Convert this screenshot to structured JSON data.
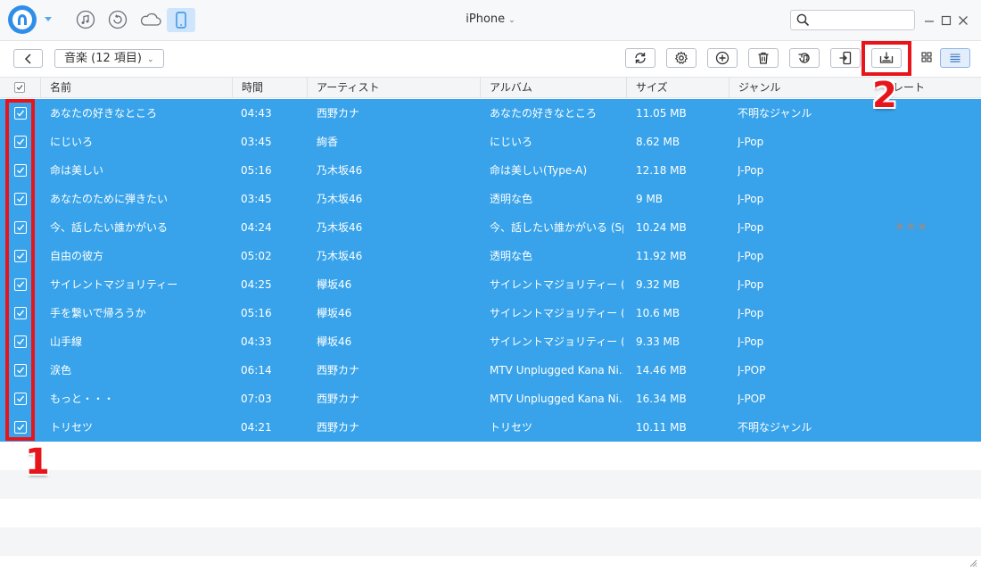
{
  "titlebar": {
    "device_name": "iPhone",
    "dropdown_glyph": "⌄",
    "search": {
      "value": "",
      "placeholder": ""
    },
    "mode_icons": [
      "music-icon",
      "restore-icon",
      "cloud-icon",
      "phone-icon"
    ],
    "accent_color": "#2f8fe8"
  },
  "toolbar": {
    "category_label": "音楽 (12 項目)",
    "dropdown_glyph": "⌄",
    "buttons": [
      "refresh-icon",
      "settings-icon",
      "add-icon",
      "delete-icon",
      "to-itunes-icon",
      "to-device-icon",
      "to-computer-icon",
      "grid-view-icon",
      "list-view-icon"
    ]
  },
  "table": {
    "columns": {
      "name": "名前",
      "time": "時間",
      "artist": "アーティスト",
      "album": "アルバム",
      "size": "サイズ",
      "genre": "ジャンル",
      "rating": "レート"
    },
    "selection_color": "#38a3ea",
    "rows": [
      {
        "name": "あなたの好きなところ",
        "time": "04:43",
        "artist": "西野カナ",
        "album": "あなたの好きなところ",
        "size": "11.05 MB",
        "genre": "不明なジャンル",
        "rating": ""
      },
      {
        "name": "にじいろ",
        "time": "03:45",
        "artist": "絢香",
        "album": "にじいろ",
        "size": "8.62 MB",
        "genre": "J-Pop",
        "rating": ""
      },
      {
        "name": "命は美しい",
        "time": "05:16",
        "artist": "乃木坂46",
        "album": "命は美しい(Type-A)",
        "size": "12.18 MB",
        "genre": "J-Pop",
        "rating": ""
      },
      {
        "name": "あなたのために弾きたい",
        "time": "03:45",
        "artist": "乃木坂46",
        "album": "透明な色",
        "size": "9 MB",
        "genre": "J-Pop",
        "rating": ""
      },
      {
        "name": "今、話したい誰かがいる",
        "time": "04:24",
        "artist": "乃木坂46",
        "album": "今、話したい誰かがいる (Sp...",
        "size": "10.24 MB",
        "genre": "J-Pop",
        "rating": "★★★"
      },
      {
        "name": "自由の彼方",
        "time": "05:02",
        "artist": "乃木坂46",
        "album": "透明な色",
        "size": "11.92 MB",
        "genre": "J-Pop",
        "rating": ""
      },
      {
        "name": "サイレントマジョリティー",
        "time": "04:25",
        "artist": "欅坂46",
        "album": "サイレントマジョリティー (Spec...",
        "size": "9.32 MB",
        "genre": "J-Pop",
        "rating": ""
      },
      {
        "name": "手を繋いで帰ろうか",
        "time": "05:16",
        "artist": "欅坂46",
        "album": "サイレントマジョリティー (Spec...",
        "size": "10.6 MB",
        "genre": "J-Pop",
        "rating": ""
      },
      {
        "name": "山手線",
        "time": "04:33",
        "artist": "欅坂46",
        "album": "サイレントマジョリティー (Spec...",
        "size": "9.33 MB",
        "genre": "J-Pop",
        "rating": ""
      },
      {
        "name": "涙色",
        "time": "06:14",
        "artist": "西野カナ",
        "album": "MTV Unplugged Kana Ni...",
        "size": "14.46 MB",
        "genre": "J-POP",
        "rating": ""
      },
      {
        "name": "もっと・・・",
        "time": "07:03",
        "artist": "西野カナ",
        "album": "MTV Unplugged Kana Ni...",
        "size": "16.34 MB",
        "genre": "J-POP",
        "rating": ""
      },
      {
        "name": "トリセツ",
        "time": "04:21",
        "artist": "西野カナ",
        "album": "トリセツ",
        "size": "10.11 MB",
        "genre": "不明なジャンル",
        "rating": ""
      }
    ]
  },
  "annotations": {
    "step1": "1",
    "step2": "2",
    "highlight_color": "#e8141c"
  }
}
